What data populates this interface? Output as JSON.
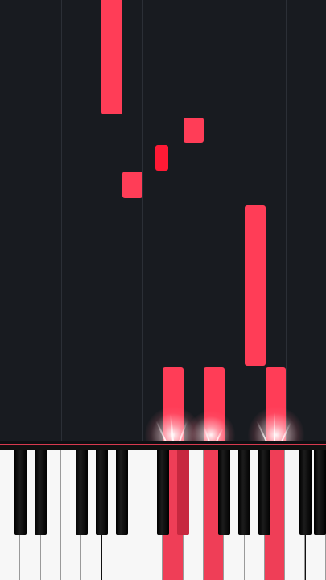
{
  "game": {
    "type": "piano-visualizer",
    "colors": {
      "note": "#ff3d57",
      "note_active": "#ff2b45",
      "background": "#181b20",
      "white_key": "#f7f7f7",
      "active_key": "#ef3e57",
      "black_key": "#000000"
    },
    "keyboard": {
      "active_white_keys": [
        8,
        10,
        13
      ],
      "active_black_keys": [
        6
      ]
    }
  }
}
